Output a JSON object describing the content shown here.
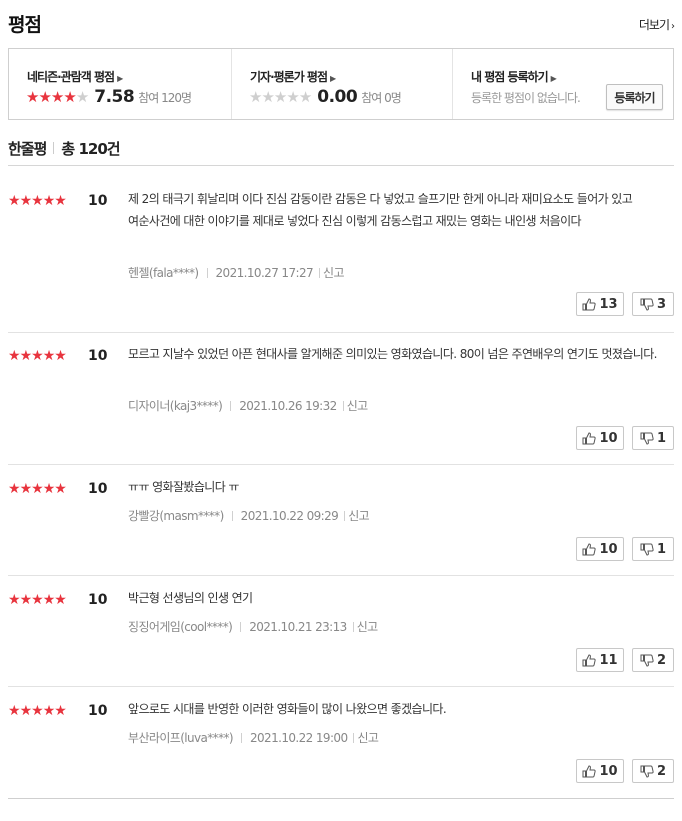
{
  "header": {
    "title": "평점",
    "more_label": "더보기",
    "more_arrow": "›"
  },
  "summary": {
    "netizen": {
      "label": "네티즌·관람객 평점",
      "stars_on": 4,
      "score": "7.58",
      "count": "참여 120명"
    },
    "critic": {
      "label": "기자·평론가 평점",
      "stars_on": 0,
      "score": "0.00",
      "count": "참여 0명"
    },
    "mine": {
      "label": "내 평점 등록하기",
      "desc": "등록한 평점이 없습니다.",
      "button": "등록하기"
    }
  },
  "reviews_header": {
    "title": "한줄평",
    "total_prefix": "총",
    "total_count": "120",
    "total_suffix": "건"
  },
  "reviews": [
    {
      "score": "10",
      "text": "제 2의 태극기 휘날리며 이다 진심 감동이란 감동은 다 넣었고 슬프기만 한게 아니라 재미요소도 들어가 있고 여순사건에 대한 이야기를 제대로 넣었다 진심 이렇게 감동스럽고 재밌는 영화는 내인생 처음이다",
      "author": "헨젤(fala****)",
      "date": "2021.10.27 17:27",
      "report": "신고",
      "likes": "13",
      "dislikes": "3"
    },
    {
      "score": "10",
      "text": "모르고 지날수 있었던 아픈 현대사를 알게해준 의미있는 영화였습니다. 80이 넘은 주연배우의 연기도 멋졌습니다.",
      "author": "디자이너(kaj3****)",
      "date": "2021.10.26 19:32",
      "report": "신고",
      "likes": "10",
      "dislikes": "1"
    },
    {
      "score": "10",
      "text": "ㅠㅠ 영화잘봤습니다 ㅠ",
      "author": "강빨강(masm****)",
      "date": "2021.10.22 09:29",
      "report": "신고",
      "likes": "10",
      "dislikes": "1"
    },
    {
      "score": "10",
      "text": "박근형 선생님의 인생 연기",
      "author": "징징어게임(cool****)",
      "date": "2021.10.21 23:13",
      "report": "신고",
      "likes": "11",
      "dislikes": "2"
    },
    {
      "score": "10",
      "text": "앞으로도 시대를 반영한 이러한 영화들이 많이 나왔으면 좋겠습니다.",
      "author": "부산라이프(luva****)",
      "date": "2021.10.22 19:00",
      "report": "신고",
      "likes": "10",
      "dislikes": "2"
    }
  ],
  "colors": {
    "star_on": "#e8343e",
    "star_off": "#cfcfcf"
  }
}
